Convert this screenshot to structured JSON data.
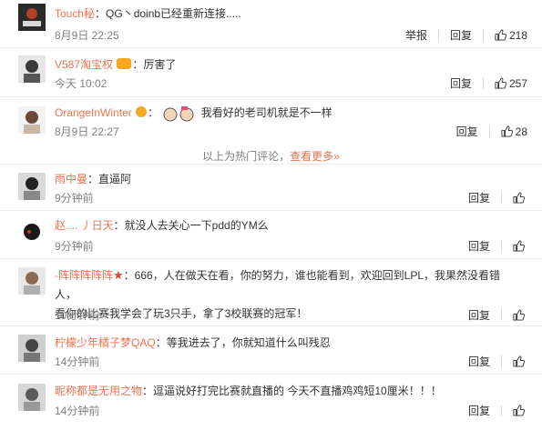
{
  "comments": [
    {
      "username": "Touch秘",
      "text": "：QG丶doinb已经重新连接.....",
      "time": "8月9日 22:25",
      "report": "举报",
      "reply": "回复",
      "likes": "218"
    },
    {
      "username": "V587淘宝权",
      "text": "：厉害了",
      "time": "今天 10:02",
      "reply": "回复",
      "likes": "257"
    },
    {
      "username": "OrangeInWinter",
      "text": "我看好的老司机就是不一样",
      "colon": "：",
      "time": "8月9日 22:27",
      "reply": "回复",
      "likes": "28"
    }
  ],
  "hot_divider": {
    "text": "以上为热门评论，",
    "more": "查看更多»"
  },
  "recent": [
    {
      "username": "雨中曼",
      "text": "：直逼阿",
      "time": "9分钟前",
      "reply": "回复"
    },
    {
      "username": "赵.... 丿日天",
      "text": "：就没人去关心一下pdd的YM么",
      "time": "9分钟前",
      "reply": "回复"
    },
    {
      "username": "-阵阵阵阵阵",
      "text": "：666，人在做天在看，你的努力，谁也能看到，欢迎回到LPL，我果然没看错人，",
      "text2": "看你的比赛我学会了玩3只手，拿了3校联赛的冠军！",
      "time": "10分钟前",
      "reply": "回复"
    },
    {
      "username": "柠檬少年橘子梦QAQ",
      "text": "：等我进去了，你就知道什么叫残忍",
      "time": "14分钟前",
      "reply": "回复"
    },
    {
      "username": "昵称都是无用之物",
      "text": "：逗逼说好打完比赛就直播的 今天不直播鸡鸡短10厘米！！！",
      "time": "14分钟前",
      "reply": "回复"
    }
  ],
  "colors": {
    "username": "#eb7350",
    "meta": "#808080",
    "text": "#333333",
    "badge_gold": "#f5a623",
    "badge_red": "#e8402f"
  }
}
